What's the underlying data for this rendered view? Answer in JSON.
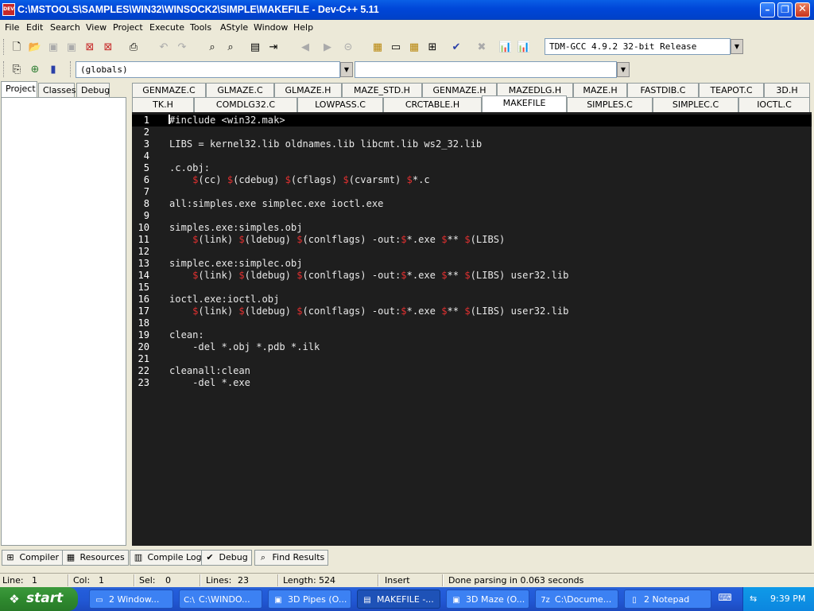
{
  "window": {
    "title": "C:\\MSTOOLS\\SAMPLES\\WIN32\\WINSOCK2\\SIMPLE\\MAKEFILE - Dev-C++ 5.11",
    "app_icon_text": "DEV",
    "min": "–",
    "max": "❐",
    "close": "✕"
  },
  "menu": [
    "File",
    "Edit",
    "Search",
    "View",
    "Project",
    "Execute",
    "Tools",
    "AStyle",
    "Window",
    "Help"
  ],
  "toolbar": {
    "compiler": "TDM-GCC 4.9.2 32-bit Release",
    "scope": "(globals)",
    "member": ""
  },
  "left_tabs": [
    "Project",
    "Classes",
    "Debug"
  ],
  "file_tabs_row1": [
    "GENMAZE.C",
    "GLMAZE.C",
    "GLMAZE.H",
    "MAZE_STD.H",
    "GENMAZE.H",
    "MAZEDLG.H",
    "MAZE.H",
    "FASTDIB.C",
    "TEAPOT.C",
    "3D.H"
  ],
  "file_tabs_row2": [
    "TK.H",
    "COMDLG32.C",
    "LOWPASS.C",
    "CRCTABLE.H",
    "MAKEFILE",
    "SIMPLES.C",
    "SIMPLEC.C",
    "IOCTL.C"
  ],
  "active_file": "MAKEFILE",
  "code_lines": [
    "#include <win32.mak>",
    "",
    "LIBS = kernel32.lib oldnames.lib libcmt.lib ws2_32.lib",
    "",
    ".c.obj:",
    "    $(cc) $(cdebug) $(cflags) $(cvarsmt) $*.c",
    "",
    "all:simples.exe simplec.exe ioctl.exe",
    "",
    "simples.exe:simples.obj",
    "    $(link) $(ldebug) $(conlflags) -out:$*.exe $** $(LIBS)",
    "",
    "simplec.exe:simplec.obj",
    "    $(link) $(ldebug) $(conlflags) -out:$*.exe $** $(LIBS) user32.lib",
    "",
    "ioctl.exe:ioctl.obj",
    "    $(link) $(ldebug) $(conlflags) -out:$*.exe $** $(LIBS) user32.lib",
    "",
    "clean:",
    "    -del *.obj *.pdb *.ilk",
    "",
    "cleanall:clean",
    "    -del *.exe"
  ],
  "bottom_tabs": [
    {
      "label": "Compiler",
      "icon": "⊞"
    },
    {
      "label": "Resources",
      "icon": "▦"
    },
    {
      "label": "Compile Log",
      "icon": "▥"
    },
    {
      "label": "Debug",
      "icon": "✔"
    },
    {
      "label": "Find Results",
      "icon": "⌕"
    }
  ],
  "status": {
    "line_label": "Line:",
    "line": "1",
    "col_label": "Col:",
    "col": "1",
    "sel_label": "Sel:",
    "sel": "0",
    "lines_label": "Lines:",
    "lines": "23",
    "length_label": "Length:",
    "length": "524",
    "mode": "Insert",
    "message": "Done parsing in 0.063 seconds"
  },
  "taskbar": {
    "start": "start",
    "tasks": [
      {
        "label": "2 Window...",
        "icon": "▭"
      },
      {
        "label": "C:\\WINDO...",
        "icon": "C:\\"
      },
      {
        "label": "3D Pipes (O...",
        "icon": "▣"
      },
      {
        "label": "MAKEFILE -...",
        "icon": "▤"
      },
      {
        "label": "3D Maze (O...",
        "icon": "▣"
      },
      {
        "label": "C:\\Docume...",
        "icon": "7z"
      },
      {
        "label": "2 Notepad",
        "icon": "▯"
      }
    ],
    "clock": "9:39 PM"
  }
}
